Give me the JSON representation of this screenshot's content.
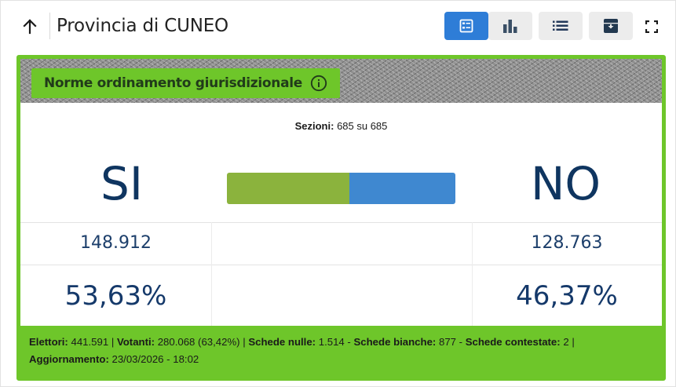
{
  "header": {
    "title": "Provincia di CUNEO",
    "icons": {
      "back": "arrow-up-icon",
      "card_view": "card-view-icon",
      "chart_view": "bar-chart-icon",
      "list_view": "list-icon",
      "archive": "archive-icon",
      "fullscreen": "fullscreen-icon"
    },
    "active_view": "card_view"
  },
  "card": {
    "title": "Norme ordinamento giurisdizionale",
    "sections_label": "Sezioni:",
    "sections_value": "685 su 685",
    "yes_label": "SI",
    "no_label": "NO",
    "yes_votes": "148.912",
    "no_votes": "128.763",
    "yes_percent": "53,63%",
    "no_percent": "46,37%",
    "yes_fraction": 0.5363,
    "no_fraction": 0.4637,
    "colors": {
      "accent": "#6ec62a",
      "yes_bar": "#8bb33d",
      "no_bar": "#3f88d0",
      "numbers": "#0f3560",
      "active_button": "#2e7dd7"
    }
  },
  "footer": {
    "elettori_label": "Elettori:",
    "elettori_value": "441.591",
    "votanti_label": "Votanti:",
    "votanti_value": "280.068 (63,42%)",
    "nulle_label": "Schede nulle:",
    "nulle_value": "1.514",
    "bianche_label": "Schede bianche:",
    "bianche_value": "877",
    "contestate_label": "Schede contestate:",
    "contestate_value": "2",
    "aggiornamento_label": "Aggiornamento:",
    "aggiornamento_value": "23/03/2026 - 18:02"
  }
}
